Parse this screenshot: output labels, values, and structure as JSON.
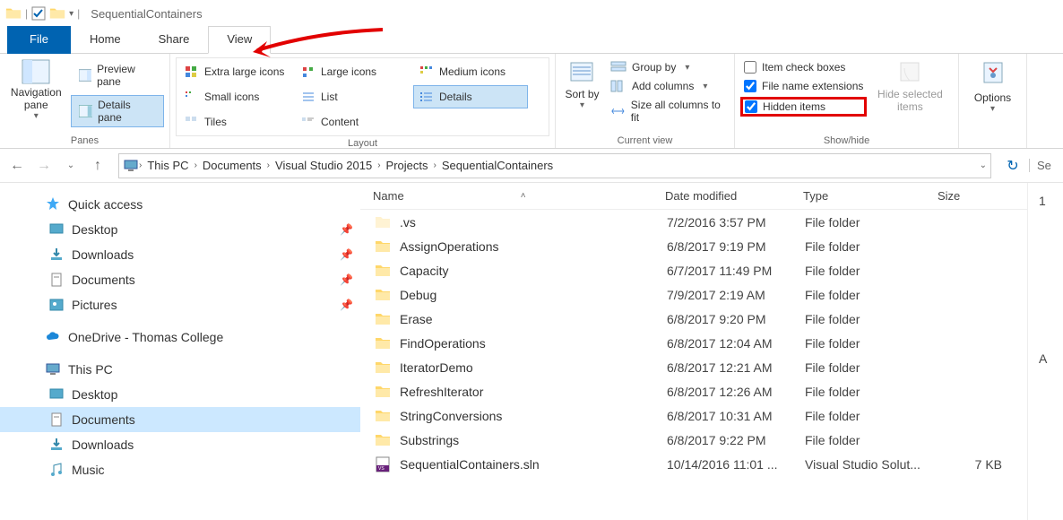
{
  "window": {
    "title": "SequentialContainers"
  },
  "tabs": {
    "file": "File",
    "home": "Home",
    "share": "Share",
    "view": "View"
  },
  "ribbon": {
    "panes": {
      "nav": "Navigation pane",
      "preview": "Preview pane",
      "details": "Details pane",
      "label": "Panes"
    },
    "layout": {
      "items": {
        "xl": "Extra large icons",
        "lg": "Large icons",
        "md": "Medium icons",
        "sm": "Small icons",
        "list": "List",
        "details": "Details",
        "tiles": "Tiles",
        "content": "Content"
      },
      "label": "Layout"
    },
    "current": {
      "sort": "Sort by",
      "group": "Group by",
      "addcols": "Add columns",
      "sizecols": "Size all columns to fit",
      "label": "Current view"
    },
    "showhide": {
      "itemcheck": "Item check boxes",
      "ext": "File name extensions",
      "hidden": "Hidden items",
      "hidesel": "Hide selected items",
      "label": "Show/hide"
    },
    "options": "Options"
  },
  "breadcrumb": [
    "This PC",
    "Documents",
    "Visual Studio 2015",
    "Projects",
    "SequentialContainers"
  ],
  "search_fragment": "Se",
  "tree": {
    "quick": "Quick access",
    "quick_items": [
      {
        "label": "Desktop",
        "pinned": true
      },
      {
        "label": "Downloads",
        "pinned": true
      },
      {
        "label": "Documents",
        "pinned": true
      },
      {
        "label": "Pictures",
        "pinned": true
      }
    ],
    "onedrive": "OneDrive - Thomas College",
    "thispc": "This PC",
    "pc_items": [
      {
        "label": "Desktop"
      },
      {
        "label": "Documents",
        "sel": true
      },
      {
        "label": "Downloads"
      },
      {
        "label": "Music"
      }
    ]
  },
  "columns": {
    "name": "Name",
    "date": "Date modified",
    "type": "Type",
    "size": "Size"
  },
  "files": [
    {
      "name": ".vs",
      "date": "7/2/2016 3:57 PM",
      "type": "File folder",
      "size": "",
      "icon": "folder-hidden"
    },
    {
      "name": "AssignOperations",
      "date": "6/8/2017 9:19 PM",
      "type": "File folder",
      "size": "",
      "icon": "folder"
    },
    {
      "name": "Capacity",
      "date": "6/7/2017 11:49 PM",
      "type": "File folder",
      "size": "",
      "icon": "folder"
    },
    {
      "name": "Debug",
      "date": "7/9/2017 2:19 AM",
      "type": "File folder",
      "size": "",
      "icon": "folder"
    },
    {
      "name": "Erase",
      "date": "6/8/2017 9:20 PM",
      "type": "File folder",
      "size": "",
      "icon": "folder"
    },
    {
      "name": "FindOperations",
      "date": "6/8/2017 12:04 AM",
      "type": "File folder",
      "size": "",
      "icon": "folder"
    },
    {
      "name": "IteratorDemo",
      "date": "6/8/2017 12:21 AM",
      "type": "File folder",
      "size": "",
      "icon": "folder"
    },
    {
      "name": "RefreshIterator",
      "date": "6/8/2017 12:26 AM",
      "type": "File folder",
      "size": "",
      "icon": "folder"
    },
    {
      "name": "StringConversions",
      "date": "6/8/2017 10:31 AM",
      "type": "File folder",
      "size": "",
      "icon": "folder"
    },
    {
      "name": "Substrings",
      "date": "6/8/2017 9:22 PM",
      "type": "File folder",
      "size": "",
      "icon": "folder"
    },
    {
      "name": "SequentialContainers.sln",
      "date": "10/14/2016 11:01 ...",
      "type": "Visual Studio Solut...",
      "size": "7 KB",
      "icon": "sln"
    }
  ],
  "right_count": "1",
  "right_letter": "A"
}
